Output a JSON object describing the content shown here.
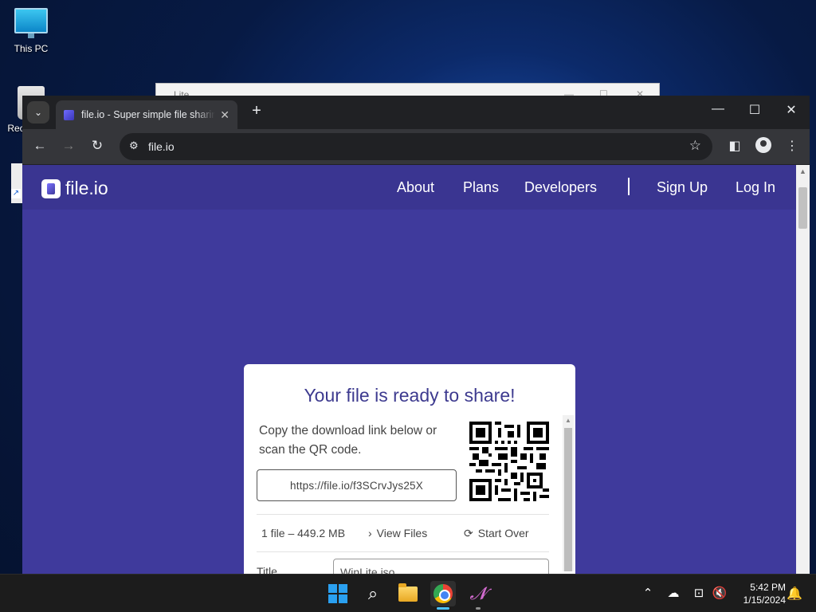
{
  "desktop": {
    "icons": [
      {
        "label": "This PC",
        "icon": "computer-icon"
      },
      {
        "label": "Rec",
        "icon": "recycle-bin-icon"
      }
    ],
    "background_window_title": "…Lite"
  },
  "browser": {
    "tab": {
      "title": "file.io - Super simple file sharing",
      "favicon": "fileio-favicon-icon"
    },
    "new_tab_symbol": "+",
    "window_controls": {
      "minimize": "—",
      "maximize": "☐",
      "close": "✕"
    },
    "address": "file.io"
  },
  "site": {
    "logo_text": "file.io",
    "nav": {
      "about": "About",
      "plans": "Plans",
      "developers": "Developers",
      "signup": "Sign Up",
      "login": "Log In"
    },
    "brand_color": "#3f3a9c"
  },
  "share_card": {
    "heading": "Your file is ready to share!",
    "instructions": "Copy the download link below or scan the QR code.",
    "link": "https://file.io/f3SCrvJys25X",
    "file_summary": "1 file – 449.2 MB",
    "view_files_label": "View Files",
    "start_over_label": "Start Over",
    "title_label": "Title",
    "title_value": "WinLite.iso"
  },
  "taskbar": {
    "apps": [
      "start-icon",
      "search-icon",
      "file-explorer-icon",
      "chrome-icon",
      "ink-app-icon"
    ],
    "time": "5:42 PM",
    "date": "1/15/2024"
  }
}
